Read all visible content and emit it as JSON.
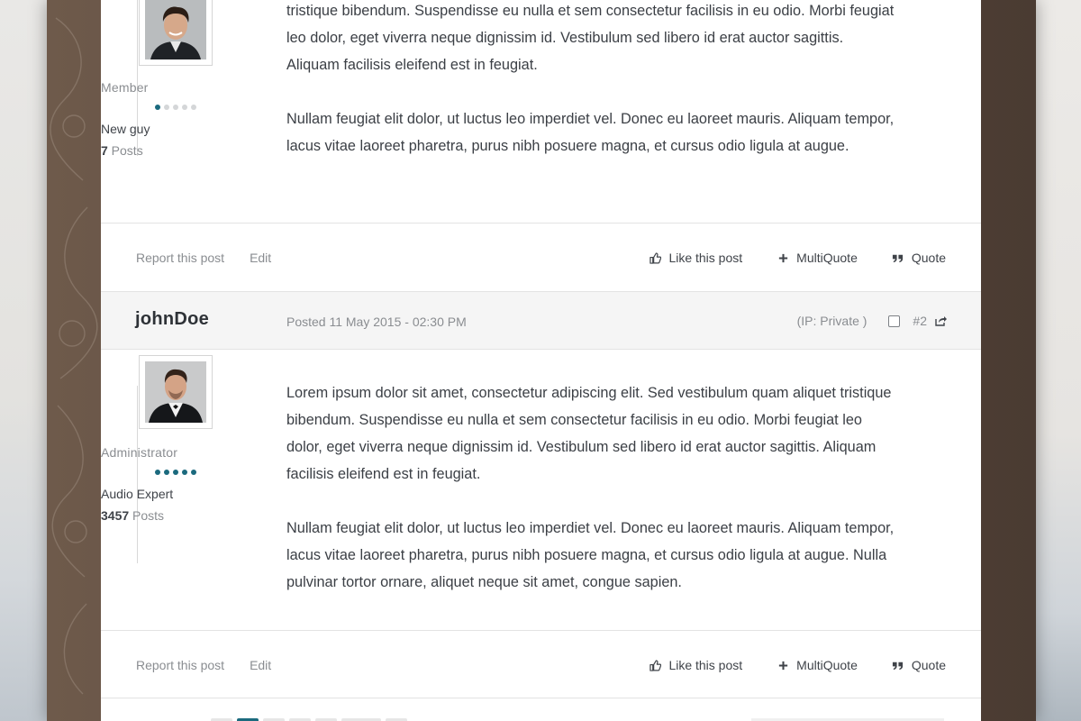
{
  "colors": {
    "accent": "#1b6a7e",
    "muted_text": "#8a8d91",
    "text": "#3b3f45"
  },
  "posts": [
    {
      "user": {
        "rank": "Member",
        "rank_level": 1,
        "rank_max": 5,
        "title": "New guy",
        "post_count": "7",
        "posts_label": " Posts"
      },
      "paragraphs": [
        "tristique bibendum. Suspendisse eu nulla et sem consectetur facilisis in eu odio. Morbi feugiat leo dolor, eget viverra neque dignissim id. Vestibulum sed libero id erat auctor sagittis. Aliquam facilisis eleifend est in feugiat.",
        "Nullam feugiat elit dolor, ut luctus leo imperdiet vel. Donec eu laoreet mauris. Aliquam tempor, lacus vitae laoreet pharetra, purus nibh posuere magna, et cursus odio ligula at augue."
      ],
      "actions": {
        "report": "Report this post",
        "edit": "Edit",
        "like": "Like this post",
        "multiquote": "MultiQuote",
        "quote": "Quote"
      }
    },
    {
      "header": {
        "author": "johnDoe",
        "posted": "Posted 11 May 2015 - 02:30 PM",
        "ip": "(IP: Private )",
        "post_number": "#2"
      },
      "user": {
        "rank": "Administrator",
        "rank_level": 5,
        "rank_max": 5,
        "title": "Audio Expert",
        "post_count": "3457",
        "posts_label": " Posts"
      },
      "paragraphs": [
        "Lorem ipsum dolor sit amet, consectetur adipiscing elit. Sed vestibulum quam aliquet tristique bibendum. Suspendisse eu nulla et sem consectetur facilisis in eu odio. Morbi feugiat leo dolor, eget viverra neque dignissim id. Vestibulum sed libero id erat auctor sagittis. Aliquam facilisis eleifend est in feugiat.",
        "Nullam feugiat elit dolor, ut luctus leo imperdiet vel. Donec eu laoreet mauris. Aliquam tempor, lacus vitae laoreet pharetra, purus nibh posuere magna, et cursus odio ligula at augue. Nulla pulvinar tortor ornare, aliquet neque sit amet, congue sapien."
      ],
      "actions": {
        "report": "Report this post",
        "edit": "Edit",
        "like": "Like this post",
        "multiquote": "MultiQuote",
        "quote": "Quote"
      }
    }
  ],
  "icons": {
    "like": "thumbs-up-icon",
    "multiquote": "plus-icon",
    "quote": "quote-icon",
    "share": "share-icon",
    "select": "checkbox-icon"
  }
}
